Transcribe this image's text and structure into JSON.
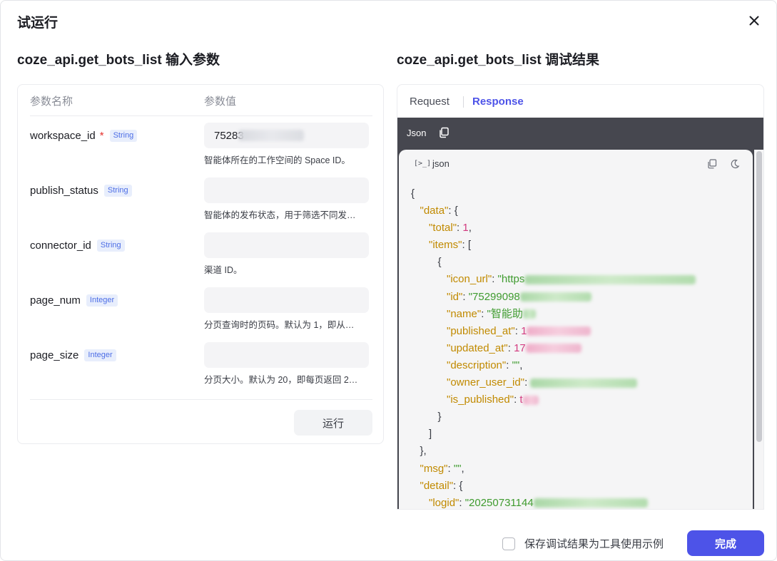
{
  "dialog": {
    "title": "试运行"
  },
  "left": {
    "section_title": "coze_api.get_bots_list 输入参数",
    "header_name": "参数名称",
    "header_value": "参数值",
    "params": [
      {
        "name": "workspace_id",
        "required": "*",
        "type": "String",
        "value": "75283",
        "desc": "智能体所在的工作空间的 Space ID。"
      },
      {
        "name": "publish_status",
        "type": "String",
        "value": "",
        "desc": "智能体的发布状态，用于筛选不同发…"
      },
      {
        "name": "connector_id",
        "type": "String",
        "value": "",
        "desc": "渠道 ID。"
      },
      {
        "name": "page_num",
        "type": "Integer",
        "value": "",
        "desc": "分页查询时的页码。默认为 1，即从…"
      },
      {
        "name": "page_size",
        "type": "Integer",
        "value": "",
        "desc": "分页大小。默认为 20，即每页返回 2…"
      }
    ],
    "run_label": "运行"
  },
  "right": {
    "section_title": "coze_api.get_bots_list 调试结果",
    "tabs": {
      "request": "Request",
      "response": "Response"
    },
    "json_bar_label": "Json",
    "code_lang": "json",
    "code_head_icon": "[>_]",
    "code": {
      "open_brace": "{",
      "data_key": "\"data\"",
      "total_key": "\"total\"",
      "total_value": "1",
      "items_key": "\"items\"",
      "item_open": "{",
      "icon_url_key": "\"icon_url\"",
      "icon_url_value": "\"https",
      "id_key": "\"id\"",
      "id_value": "\"75299098",
      "name_key": "\"name\"",
      "name_value": "\"智能助",
      "published_at_key": "\"published_at\"",
      "published_at_value": "1",
      "updated_at_key": "\"updated_at\"",
      "updated_at_value": "17",
      "description_key": "\"description\"",
      "description_value": "\"\"",
      "owner_user_id_key": "\"owner_user_id\"",
      "is_published_key": "\"is_published\"",
      "is_published_value": "t",
      "item_close": "}",
      "items_close": "]",
      "data_close": "},",
      "msg_key": "\"msg\"",
      "msg_value": "\"\"",
      "detail_key": "\"detail\"",
      "logid_key": "\"logid\"",
      "logid_value": "\"20250731144"
    }
  },
  "footer": {
    "save_example_label": "保存调试结果为工具使用示例",
    "done_label": "完成"
  },
  "colors": {
    "primary": "#4d53e8",
    "json_key": "#c18a00",
    "json_string": "#3f9b2f",
    "json_number": "#d23a7f",
    "required": "#e5322d",
    "code_bar": "#46474f"
  },
  "icons": {
    "close": "close-icon",
    "copy": "copy-icon",
    "theme": "moon-icon",
    "terminal": "terminal-icon"
  }
}
